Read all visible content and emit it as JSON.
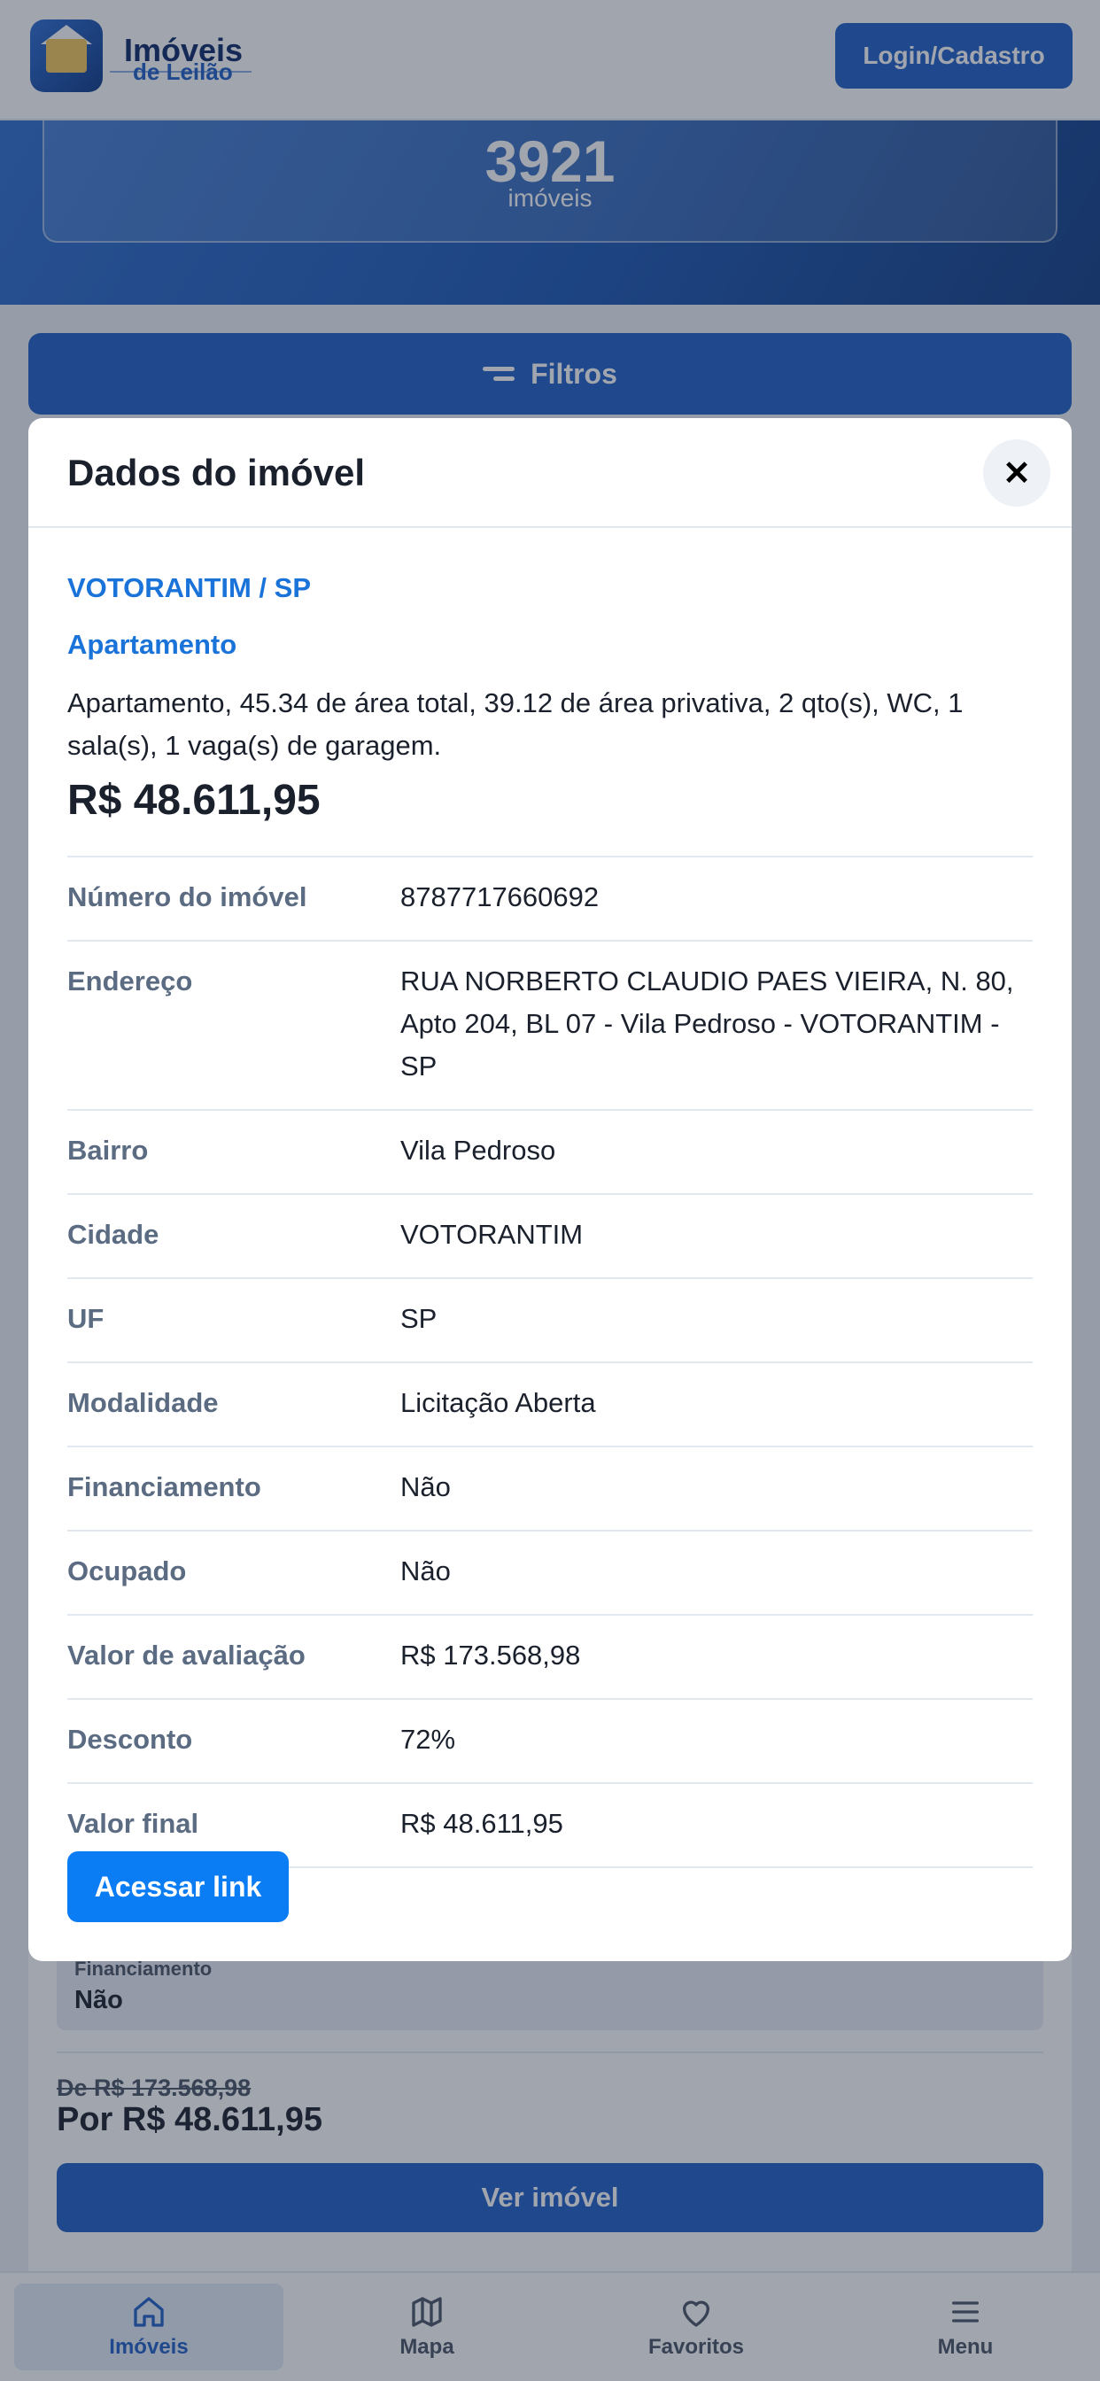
{
  "header": {
    "logo_line1": "Imóveis",
    "logo_line2": "de Leilão",
    "login_label": "Login/Cadastro"
  },
  "hero": {
    "count": "3921",
    "count_label": "imóveis"
  },
  "filters_label": "Filtros",
  "background_listing": {
    "financing_label": "Financiamento",
    "financing_value": "Não",
    "old_price": "De R$ 173.568,98",
    "new_price": "Por R$ 48.611,95",
    "view_button": "Ver imóvel"
  },
  "modal": {
    "title": "Dados do imóvel",
    "location": "VOTORANTIM / SP",
    "property_type": "Apartamento",
    "description": "Apartamento, 45.34 de área total, 39.12 de área privativa, 2 qto(s), WC, 1 sala(s), 1 vaga(s) de garagem.",
    "price": "R$ 48.611,95",
    "details": [
      {
        "label": "Número do imóvel",
        "value": "8787717660692"
      },
      {
        "label": "Endereço",
        "value": "RUA NORBERTO CLAUDIO PAES VIEIRA, N. 80, Apto 204, BL 07 - Vila Pedroso - VOTORANTIM - SP"
      },
      {
        "label": "Bairro",
        "value": "Vila Pedroso"
      },
      {
        "label": "Cidade",
        "value": "VOTORANTIM"
      },
      {
        "label": "UF",
        "value": "SP"
      },
      {
        "label": "Modalidade",
        "value": "Licitação Aberta"
      },
      {
        "label": "Financiamento",
        "value": "Não"
      },
      {
        "label": "Ocupado",
        "value": "Não"
      },
      {
        "label": "Valor de avaliação",
        "value": "R$ 173.568,98"
      },
      {
        "label": "Desconto",
        "value": "72%"
      },
      {
        "label": "Valor final",
        "value": "R$ 48.611,95"
      }
    ],
    "access_button": "Acessar link",
    "close_icon": "close-icon"
  },
  "bottom_nav": [
    {
      "label": "Imóveis",
      "icon": "home-icon"
    },
    {
      "label": "Mapa",
      "icon": "map-icon"
    },
    {
      "label": "Favoritos",
      "icon": "heart-icon"
    },
    {
      "label": "Menu",
      "icon": "menu-icon"
    }
  ],
  "colors": {
    "primary": "#1f5fc8",
    "accent_link": "#1a73d9",
    "access_button": "#0a7cf4"
  }
}
